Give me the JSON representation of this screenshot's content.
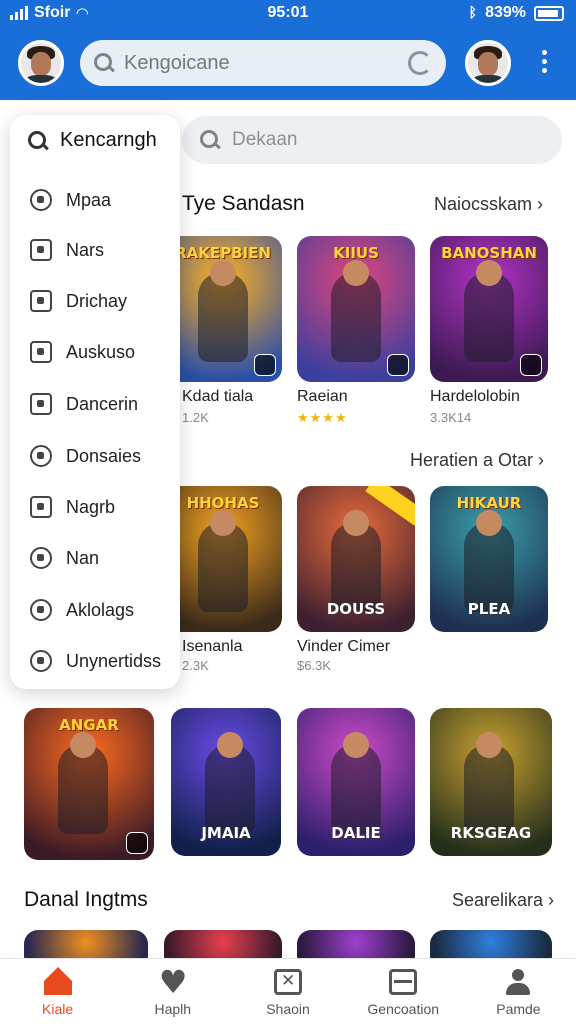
{
  "status": {
    "carrier": "Sfoir",
    "time": "95:01",
    "battery": "839%"
  },
  "header": {
    "search_placeholder": "Kengoicane"
  },
  "search2": {
    "placeholder": "Dekaan"
  },
  "menu": {
    "title": "Kencarngh",
    "items": [
      {
        "label": "Mpaa",
        "icon": "compass-icon"
      },
      {
        "label": "Nars",
        "icon": "edit-icon"
      },
      {
        "label": "Drichay",
        "icon": "calendar-icon"
      },
      {
        "label": "Auskuso",
        "icon": "chat-icon"
      },
      {
        "label": "Dancerin",
        "icon": "chart-icon"
      },
      {
        "label": "Donsaies",
        "icon": "globe-icon"
      },
      {
        "label": "Nagrb",
        "icon": "puzzle-icon"
      },
      {
        "label": "Nan",
        "icon": "smile-icon"
      },
      {
        "label": "Aklolags",
        "icon": "compass-icon"
      },
      {
        "label": "Unynertidss",
        "icon": "settings-icon"
      }
    ]
  },
  "sections": [
    {
      "title": "Tye Sandasn",
      "link": "Naiocsskam ›"
    },
    {
      "title": "",
      "link": "Heratien a Otar ›"
    },
    {
      "title": "Danal Ingtms",
      "link": "Searelikara ›"
    }
  ],
  "row1": [
    {
      "art": "RAKEPBIEN",
      "name": "",
      "sub": "",
      "colors": [
        "#ffb020",
        "#2a4fa8"
      ]
    },
    {
      "art": "KIIUS",
      "name": "",
      "sub": "",
      "colors": [
        "#e0457a",
        "#3a3f9e"
      ]
    },
    {
      "art": "BANOSHAN",
      "name": "",
      "sub": "",
      "colors": [
        "#b233c6",
        "#3b1a52"
      ]
    },
    {
      "art": "",
      "name": "Kdad tiala",
      "sub": "1.2K",
      "colors": []
    },
    {
      "art": "",
      "name": "Raeian",
      "sub": "",
      "stars": "★★★★",
      "colors": []
    },
    {
      "art": "",
      "name": "Hardelolobin",
      "sub": "3.3K14",
      "colors": []
    }
  ],
  "row2": [
    {
      "art": "HHOHAS",
      "name": "Isenanla",
      "sub": "2.3K",
      "colors": [
        "#f0a020",
        "#3b2a1a"
      ]
    },
    {
      "art": "DOUSS",
      "name": "Vinder Cimer",
      "sub": "$6.3K",
      "colors": [
        "#e86a3a",
        "#3d2030"
      ]
    },
    {
      "art": "HIKAUR",
      "name": "PLEA",
      "sub": "",
      "colors": [
        "#3aa0a8",
        "#1e3050"
      ]
    }
  ],
  "row3": [
    {
      "art": "ANGAR",
      "colors": [
        "#ff6a1f",
        "#3a1a26"
      ]
    },
    {
      "art": "JMAIA",
      "colors": [
        "#6a4ae8",
        "#10204a"
      ]
    },
    {
      "art": "DALIE",
      "colors": [
        "#d04ac8",
        "#2a1f6a"
      ]
    },
    {
      "art": "RKSGEAG",
      "colors": [
        "#c8a030",
        "#24301c"
      ]
    }
  ],
  "row4": [
    {
      "colors": [
        "#f09020",
        "#2a2a50"
      ]
    },
    {
      "colors": [
        "#e84050",
        "#3a1a2a"
      ]
    },
    {
      "colors": [
        "#a040d0",
        "#2a1a40"
      ]
    },
    {
      "colors": [
        "#3080e0",
        "#1a2a40"
      ]
    }
  ],
  "nav": [
    "Kiale",
    "Haplh",
    "Shaoin",
    "Gencoation",
    "Pamde"
  ]
}
